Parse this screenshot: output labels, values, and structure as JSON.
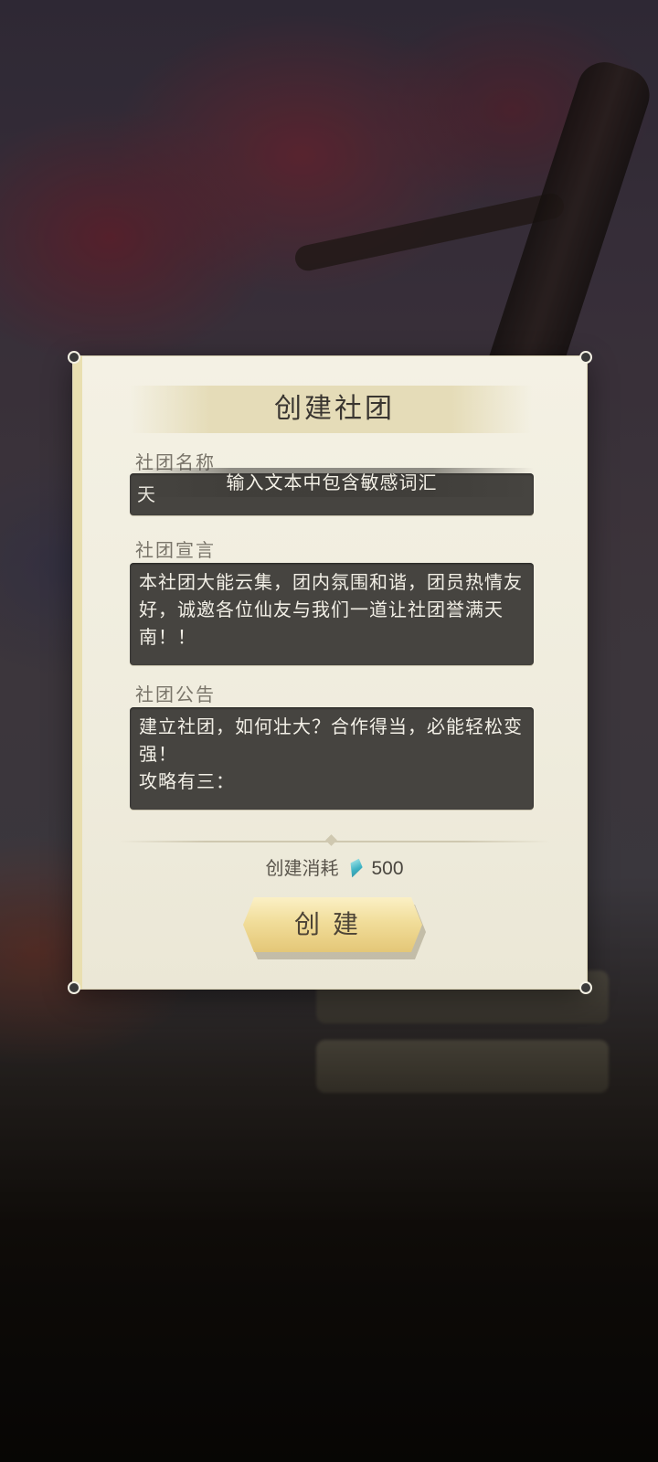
{
  "dialog": {
    "title": "创建社团",
    "name_label": "社团名称",
    "name_value": "天",
    "warning_toast": "输入文本中包含敏感词汇",
    "declaration_label": "社团宣言",
    "declaration_value": "本社团大能云集，团内氛围和谐，团员热情友好，诚邀各位仙友与我们一道让社团誉满天南！！",
    "announcement_label": "社团公告",
    "announcement_value": "建立社团，如何壮大？合作得当，必能轻松变强！\n攻略有三：",
    "cost_label": "创建消耗",
    "cost_icon": "spirit-stone-icon",
    "cost_amount": "500",
    "create_label": "创建",
    "colors": {
      "panel": "#f4f1e4",
      "field": "#464440",
      "button": "#f1dd9a"
    }
  }
}
